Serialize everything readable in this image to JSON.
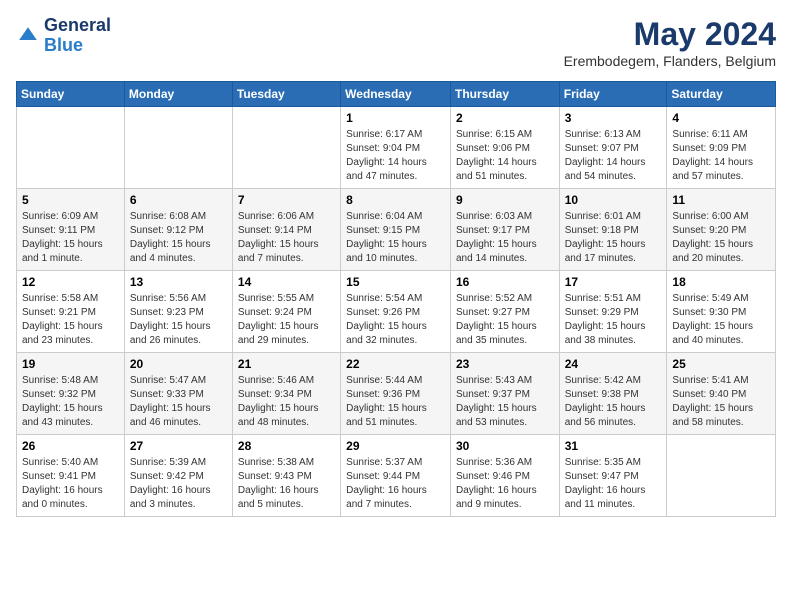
{
  "header": {
    "logo_general": "General",
    "logo_blue": "Blue",
    "month": "May 2024",
    "location": "Erembodegem, Flanders, Belgium"
  },
  "days_of_week": [
    "Sunday",
    "Monday",
    "Tuesday",
    "Wednesday",
    "Thursday",
    "Friday",
    "Saturday"
  ],
  "weeks": [
    [
      {
        "day": "",
        "info": ""
      },
      {
        "day": "",
        "info": ""
      },
      {
        "day": "",
        "info": ""
      },
      {
        "day": "1",
        "info": "Sunrise: 6:17 AM\nSunset: 9:04 PM\nDaylight: 14 hours and 47 minutes."
      },
      {
        "day": "2",
        "info": "Sunrise: 6:15 AM\nSunset: 9:06 PM\nDaylight: 14 hours and 51 minutes."
      },
      {
        "day": "3",
        "info": "Sunrise: 6:13 AM\nSunset: 9:07 PM\nDaylight: 14 hours and 54 minutes."
      },
      {
        "day": "4",
        "info": "Sunrise: 6:11 AM\nSunset: 9:09 PM\nDaylight: 14 hours and 57 minutes."
      }
    ],
    [
      {
        "day": "5",
        "info": "Sunrise: 6:09 AM\nSunset: 9:11 PM\nDaylight: 15 hours and 1 minute."
      },
      {
        "day": "6",
        "info": "Sunrise: 6:08 AM\nSunset: 9:12 PM\nDaylight: 15 hours and 4 minutes."
      },
      {
        "day": "7",
        "info": "Sunrise: 6:06 AM\nSunset: 9:14 PM\nDaylight: 15 hours and 7 minutes."
      },
      {
        "day": "8",
        "info": "Sunrise: 6:04 AM\nSunset: 9:15 PM\nDaylight: 15 hours and 10 minutes."
      },
      {
        "day": "9",
        "info": "Sunrise: 6:03 AM\nSunset: 9:17 PM\nDaylight: 15 hours and 14 minutes."
      },
      {
        "day": "10",
        "info": "Sunrise: 6:01 AM\nSunset: 9:18 PM\nDaylight: 15 hours and 17 minutes."
      },
      {
        "day": "11",
        "info": "Sunrise: 6:00 AM\nSunset: 9:20 PM\nDaylight: 15 hours and 20 minutes."
      }
    ],
    [
      {
        "day": "12",
        "info": "Sunrise: 5:58 AM\nSunset: 9:21 PM\nDaylight: 15 hours and 23 minutes."
      },
      {
        "day": "13",
        "info": "Sunrise: 5:56 AM\nSunset: 9:23 PM\nDaylight: 15 hours and 26 minutes."
      },
      {
        "day": "14",
        "info": "Sunrise: 5:55 AM\nSunset: 9:24 PM\nDaylight: 15 hours and 29 minutes."
      },
      {
        "day": "15",
        "info": "Sunrise: 5:54 AM\nSunset: 9:26 PM\nDaylight: 15 hours and 32 minutes."
      },
      {
        "day": "16",
        "info": "Sunrise: 5:52 AM\nSunset: 9:27 PM\nDaylight: 15 hours and 35 minutes."
      },
      {
        "day": "17",
        "info": "Sunrise: 5:51 AM\nSunset: 9:29 PM\nDaylight: 15 hours and 38 minutes."
      },
      {
        "day": "18",
        "info": "Sunrise: 5:49 AM\nSunset: 9:30 PM\nDaylight: 15 hours and 40 minutes."
      }
    ],
    [
      {
        "day": "19",
        "info": "Sunrise: 5:48 AM\nSunset: 9:32 PM\nDaylight: 15 hours and 43 minutes."
      },
      {
        "day": "20",
        "info": "Sunrise: 5:47 AM\nSunset: 9:33 PM\nDaylight: 15 hours and 46 minutes."
      },
      {
        "day": "21",
        "info": "Sunrise: 5:46 AM\nSunset: 9:34 PM\nDaylight: 15 hours and 48 minutes."
      },
      {
        "day": "22",
        "info": "Sunrise: 5:44 AM\nSunset: 9:36 PM\nDaylight: 15 hours and 51 minutes."
      },
      {
        "day": "23",
        "info": "Sunrise: 5:43 AM\nSunset: 9:37 PM\nDaylight: 15 hours and 53 minutes."
      },
      {
        "day": "24",
        "info": "Sunrise: 5:42 AM\nSunset: 9:38 PM\nDaylight: 15 hours and 56 minutes."
      },
      {
        "day": "25",
        "info": "Sunrise: 5:41 AM\nSunset: 9:40 PM\nDaylight: 15 hours and 58 minutes."
      }
    ],
    [
      {
        "day": "26",
        "info": "Sunrise: 5:40 AM\nSunset: 9:41 PM\nDaylight: 16 hours and 0 minutes."
      },
      {
        "day": "27",
        "info": "Sunrise: 5:39 AM\nSunset: 9:42 PM\nDaylight: 16 hours and 3 minutes."
      },
      {
        "day": "28",
        "info": "Sunrise: 5:38 AM\nSunset: 9:43 PM\nDaylight: 16 hours and 5 minutes."
      },
      {
        "day": "29",
        "info": "Sunrise: 5:37 AM\nSunset: 9:44 PM\nDaylight: 16 hours and 7 minutes."
      },
      {
        "day": "30",
        "info": "Sunrise: 5:36 AM\nSunset: 9:46 PM\nDaylight: 16 hours and 9 minutes."
      },
      {
        "day": "31",
        "info": "Sunrise: 5:35 AM\nSunset: 9:47 PM\nDaylight: 16 hours and 11 minutes."
      },
      {
        "day": "",
        "info": ""
      }
    ]
  ]
}
